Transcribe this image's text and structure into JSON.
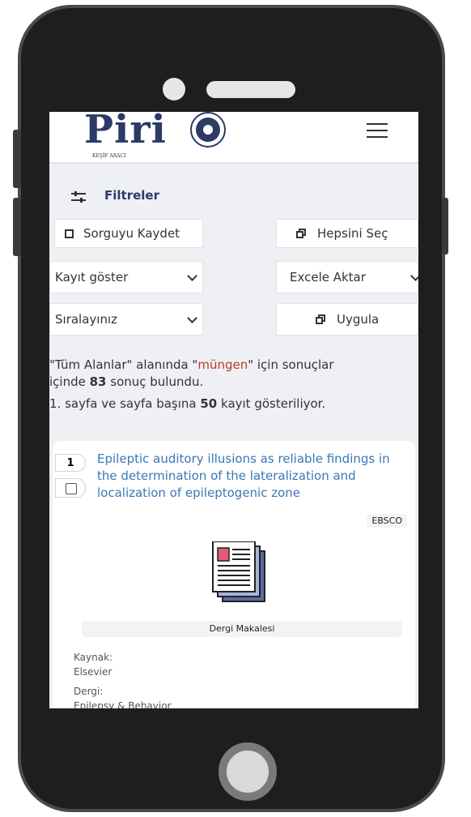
{
  "header": {
    "logo_text": "Piri",
    "logo_subtitle": "KEŞİF ARACI"
  },
  "filters": {
    "label": "Filtreler"
  },
  "toolbar": {
    "save_query": "Sorguyu Kaydet",
    "select_all": "Hepsini Seç",
    "show_records": "Kayıt göster",
    "export_excel": "Excele Aktar",
    "sort": "Sıralayınız",
    "apply": "Uygula"
  },
  "results": {
    "line1_prefix": "\"Tüm Alanlar\" alanında \"",
    "query": "müngen",
    "line1_suffix": "\" için sonuçlar",
    "line2_prefix": "içinde ",
    "count": "83",
    "line2_suffix": " sonuç bulundu.",
    "page_prefix": "1. sayfa ve sayfa başına ",
    "per_page": "50",
    "page_suffix": " kayıt gösteriliyor."
  },
  "record": {
    "number": "1",
    "title": "Epileptic auditory illusions as reliable findings in the determination of the lateralization and localization of epileptogenic zone",
    "source": "EBSCO",
    "type": "Dergi Makalesi",
    "kaynak_label": "Kaynak:",
    "kaynak_value": "Elsevier",
    "dergi_label": "Dergi:",
    "dergi_value": "Epilepsy & Behavior"
  },
  "colors": {
    "brand": "#2c3a68",
    "link": "#3a78b5",
    "highlight": "#c0392b"
  }
}
